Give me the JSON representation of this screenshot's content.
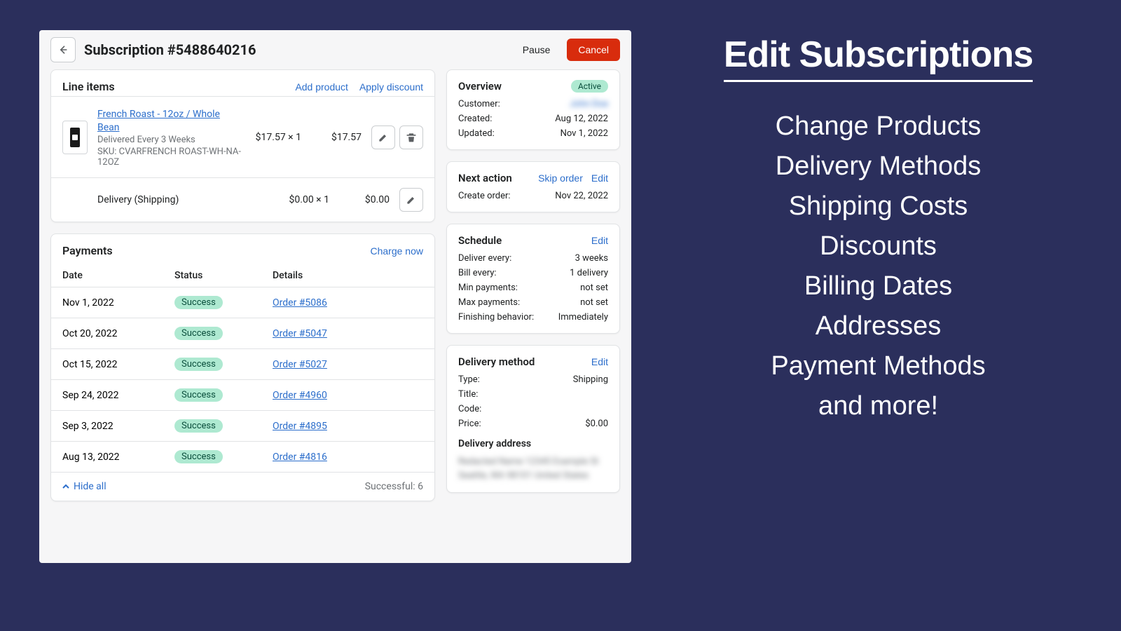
{
  "header": {
    "title": "Subscription #5488640216",
    "pause": "Pause",
    "cancel": "Cancel"
  },
  "line_items": {
    "title": "Line items",
    "add_product": "Add product",
    "apply_discount": "Apply discount",
    "product": {
      "name": "French Roast - 12oz / Whole Bean",
      "frequency": "Delivered Every 3 Weeks",
      "sku": "SKU: CVARFRENCH ROAST-WH-NA-12OZ",
      "unit": "$17.57 × 1",
      "total": "$17.57"
    },
    "shipping": {
      "label": "Delivery (Shipping)",
      "unit": "$0.00 × 1",
      "total": "$0.00"
    }
  },
  "payments": {
    "title": "Payments",
    "charge_now": "Charge now",
    "cols": {
      "date": "Date",
      "status": "Status",
      "details": "Details"
    },
    "rows": [
      {
        "date": "Nov 1, 2022",
        "status": "Success",
        "order": "Order #5086"
      },
      {
        "date": "Oct 20, 2022",
        "status": "Success",
        "order": "Order #5047"
      },
      {
        "date": "Oct 15, 2022",
        "status": "Success",
        "order": "Order #5027"
      },
      {
        "date": "Sep 24, 2022",
        "status": "Success",
        "order": "Order #4960"
      },
      {
        "date": "Sep 3, 2022",
        "status": "Success",
        "order": "Order #4895"
      },
      {
        "date": "Aug 13, 2022",
        "status": "Success",
        "order": "Order #4816"
      }
    ],
    "hide_all": "Hide all",
    "successful": "Successful: 6"
  },
  "overview": {
    "title": "Overview",
    "status": "Active",
    "customer_k": "Customer:",
    "customer_v": "John Doe",
    "created_k": "Created:",
    "created_v": "Aug 12, 2022",
    "updated_k": "Updated:",
    "updated_v": "Nov 1, 2022"
  },
  "next_action": {
    "title": "Next action",
    "skip": "Skip order",
    "edit": "Edit",
    "create_k": "Create order:",
    "create_v": "Nov 22, 2022"
  },
  "schedule": {
    "title": "Schedule",
    "edit": "Edit",
    "deliver_k": "Deliver every:",
    "deliver_v": "3 weeks",
    "bill_k": "Bill every:",
    "bill_v": "1 delivery",
    "min_k": "Min payments:",
    "min_v": "not set",
    "max_k": "Max payments:",
    "max_v": "not set",
    "fin_k": "Finishing behavior:",
    "fin_v": "Immediately"
  },
  "delivery": {
    "title": "Delivery method",
    "edit": "Edit",
    "type_k": "Type:",
    "type_v": "Shipping",
    "title_k": "Title:",
    "title_v": "",
    "code_k": "Code:",
    "code_v": "",
    "price_k": "Price:",
    "price_v": "$0.00",
    "addr_title": "Delivery address",
    "addr": "Redacted Name\n12345 Example St\nSeattle, WA 98101\nUnited States"
  },
  "promo": {
    "heading": "Edit Subscriptions",
    "lines": [
      "Change Products",
      "Delivery Methods",
      "Shipping Costs",
      "Discounts",
      "Billing Dates",
      "Addresses",
      "Payment Methods",
      "and more!"
    ]
  }
}
